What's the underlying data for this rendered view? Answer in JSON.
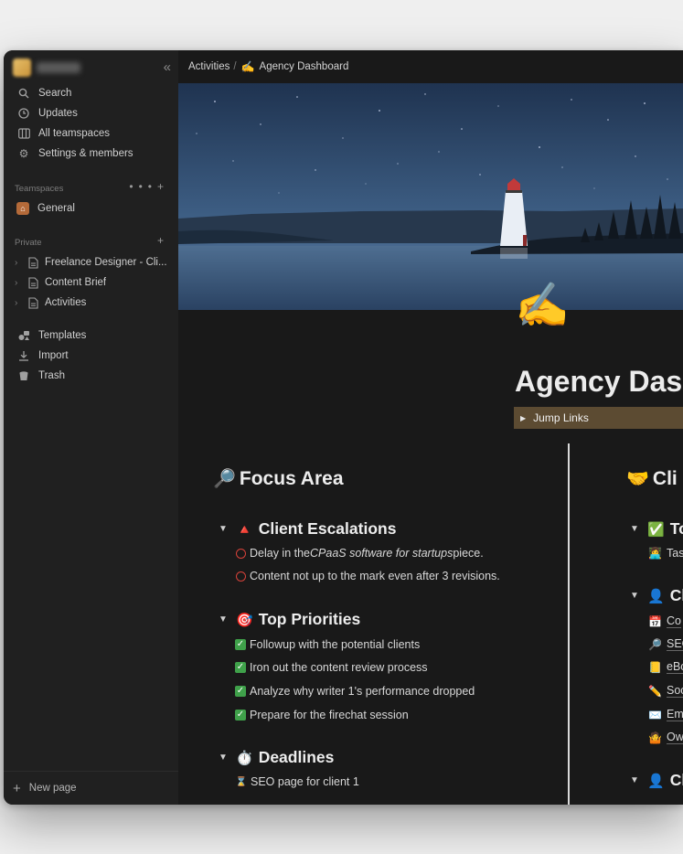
{
  "sidebar": {
    "nav": [
      {
        "label": "Search",
        "icon": "search-icon"
      },
      {
        "label": "Updates",
        "icon": "clock-icon"
      },
      {
        "label": "All teamspaces",
        "icon": "teamspaces-icon"
      },
      {
        "label": "Settings & members",
        "icon": "gear-icon"
      }
    ],
    "teamspaces_label": "Teamspaces",
    "general": "General",
    "private_label": "Private",
    "pages": [
      "Freelance Designer - Cli...",
      "Content Brief",
      "Activities"
    ],
    "tools": [
      {
        "label": "Templates",
        "icon": "templates-icon"
      },
      {
        "label": "Import",
        "icon": "import-icon"
      },
      {
        "label": "Trash",
        "icon": "trash-icon"
      }
    ],
    "new_page": "New page"
  },
  "breadcrumb": {
    "parent": "Activities",
    "separator": "/",
    "emoji": "✍️",
    "current": "Agency Dashboard"
  },
  "page": {
    "icon": "✍️",
    "title": "Agency Dasl",
    "jump_links": "Jump Links"
  },
  "left": {
    "focus": {
      "emoji": "🔎",
      "title": "Focus Area"
    },
    "escalations": {
      "emoji": "🔺",
      "title": "Client Escalations",
      "items": [
        {
          "before": "Delay in the ",
          "italic": "CPaaS software for startups",
          "after": " piece."
        },
        {
          "text": "Content not up to the mark even after 3 revisions."
        }
      ]
    },
    "priorities": {
      "emoji": "🎯",
      "title": "Top Priorities",
      "items": [
        "Followup with the potential clients",
        "Iron out the content review process",
        "Analyze why writer 1's performance dropped",
        "Prepare for the firechat session"
      ]
    },
    "deadlines": {
      "emoji": "⏱️",
      "title": "Deadlines",
      "items": [
        "SEO page for client 1"
      ]
    }
  },
  "right": {
    "heading": {
      "emoji": "🤝",
      "title": "Cli"
    },
    "toggle1": {
      "emoji": "✅",
      "title": "To"
    },
    "toggle1_items": [
      {
        "emoji": "👩‍💻",
        "text": "Tas"
      }
    ],
    "toggle2": {
      "emoji": "👤",
      "title": "Cl"
    },
    "toggle2_items": [
      {
        "emoji": "📅",
        "text": "Co"
      },
      {
        "emoji": "🔎",
        "text": "SEO"
      },
      {
        "emoji": "📒",
        "text": "eBo"
      },
      {
        "emoji": "✏️",
        "text": "Soc"
      },
      {
        "emoji": "✉️",
        "text": "Em"
      },
      {
        "emoji": "🤷",
        "text": "Ow"
      }
    ],
    "toggle3": {
      "emoji": "👤",
      "title": "Cl"
    }
  },
  "colors": {
    "accent_brown": "#5c4b32",
    "check_green": "#3fa14a",
    "ring_red": "#d8423a"
  }
}
